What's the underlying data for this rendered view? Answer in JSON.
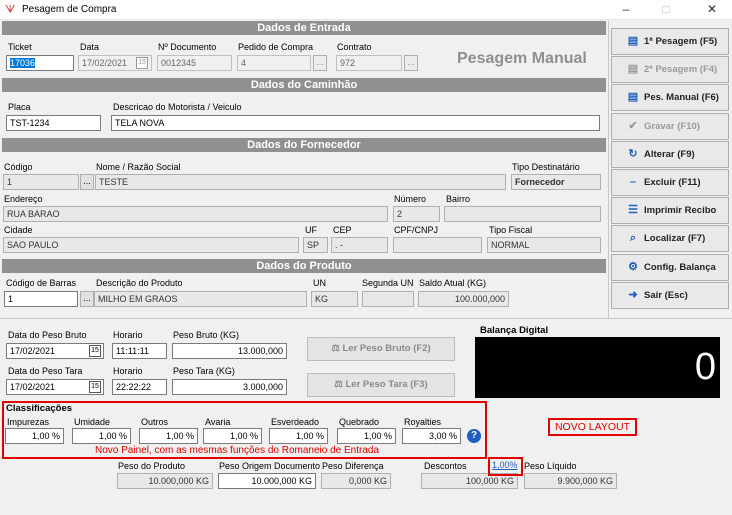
{
  "window": {
    "title": "Pesagem de Compra",
    "minimize": "–",
    "maximize": "□",
    "close": "✕"
  },
  "sections": {
    "entrada": "Dados de Entrada",
    "caminhao": "Dados do Caminhão",
    "fornecedor": "Dados do Fornecedor",
    "produto": "Dados do Produto",
    "balanca": "Balança Digital",
    "classificacoes": "Classificações"
  },
  "entrada": {
    "ticket_label": "Ticket",
    "ticket": "17036",
    "data_label": "Data",
    "data": "17/02/2021",
    "documento_label": "Nº Documento",
    "documento": "0012345",
    "pedido_label": "Pedido de Compra",
    "pedido": "4",
    "contrato_label": "Contrato",
    "contrato": "972",
    "mode_title": "Pesagem Manual",
    "dots": "..."
  },
  "caminhao": {
    "placa_label": "Placa",
    "placa": "TST-1234",
    "motorista_label": "Descricao do Motorista / Veiculo",
    "motorista": "TELA NOVA"
  },
  "fornecedor": {
    "codigo_label": "Código",
    "codigo": "1",
    "nome_label": "Nome / Razão Social",
    "nome": "TESTE",
    "tipo_label": "Tipo Destinatário",
    "tipo": "Fornecedor",
    "endereco_label": "Endereço",
    "endereco": "RUA BARAO",
    "numero_label": "Número",
    "numero": "2",
    "bairro_label": "Bairro",
    "bairro": "",
    "cidade_label": "Cidade",
    "cidade": "SAO PAULO",
    "uf_label": "UF",
    "uf": "SP",
    "cep_label": "CEP",
    "cep": " .  -",
    "cpf_label": "CPF/CNPJ",
    "cpf": "",
    "tipo_fiscal_label": "Tipo Fiscal",
    "tipo_fiscal": "NORMAL"
  },
  "produto": {
    "barras_label": "Código de Barras",
    "barras": "1",
    "descricao_label": "Descrição do Produto",
    "descricao": "MILHO EM GRAOS",
    "un_label": "UN",
    "un": "KG",
    "segunda_un_label": "Segunda UN",
    "segunda_un": "",
    "saldo_label": "Saldo Atual (KG)",
    "saldo": "100.000,000"
  },
  "pesagem": {
    "data_bruto_label": "Data do Peso Bruto",
    "data_bruto": "17/02/2021",
    "hora_bruto_label": "Horario",
    "hora_bruto": "11:11:11",
    "peso_bruto_label": "Peso Bruto (KG)",
    "peso_bruto": "13.000,000",
    "ler_bruto": "Ler Peso Bruto (F2)",
    "data_tara_label": "Data do Peso Tara",
    "data_tara": "17/02/2021",
    "hora_tara_label": "Horario",
    "hora_tara": "22:22:22",
    "peso_tara_label": "Peso Tara (KG)",
    "peso_tara": "3.000,000",
    "ler_tara": "Ler Peso Tara (F3)",
    "balanca_valor": "0",
    "cal_icon": "15"
  },
  "classificacoes": {
    "items": [
      {
        "label": "Impurezas",
        "value": "1,00 %"
      },
      {
        "label": "Umidade",
        "value": "1,00 %"
      },
      {
        "label": "Outros",
        "value": "1,00 %"
      },
      {
        "label": "Avaria",
        "value": "1,00 %"
      },
      {
        "label": "Esverdeado",
        "value": "1,00 %"
      },
      {
        "label": "Quebrado",
        "value": "1,00 %"
      },
      {
        "label": "Royalties",
        "value": "3,00 %"
      }
    ],
    "help": "?",
    "note": "Novo Painel, com as mesmas funções do Romaneio de Entrada",
    "novo_layout": "NOVO LAYOUT"
  },
  "totais": {
    "peso_produto_label": "Peso do Produto",
    "peso_produto": "10.000,000 KG",
    "peso_origem_label": "Peso Origem Documento",
    "peso_origem": "10.000,000 KG",
    "peso_diferenca_label": "Peso Diferença",
    "peso_diferenca": "0,000 KG",
    "descontos_label": "Descontos",
    "descontos": "100,000 KG",
    "descontos_pct": "1,00%",
    "peso_liquido_label": "Peso Líquido",
    "peso_liquido": "9.900,000 KG"
  },
  "sidebar": [
    {
      "label": "1ª Pesagem (F5)",
      "icon": "▤"
    },
    {
      "label": "2ª Pesagem (F4)",
      "icon": "▤"
    },
    {
      "label": "Pes. Manual (F6)",
      "icon": "▤"
    },
    {
      "label": "Gravar (F10)",
      "icon": "✔"
    },
    {
      "label": "Alterar (F9)",
      "icon": "↻"
    },
    {
      "label": "Excluir (F11)",
      "icon": "–"
    },
    {
      "label": "Imprimir Recibo",
      "icon": "☰"
    },
    {
      "label": "Localizar (F7)",
      "icon": "⌕"
    },
    {
      "label": "Config. Balança",
      "icon": "⚙"
    },
    {
      "label": "Sair (Esc)",
      "icon": "➜"
    }
  ],
  "colors": {
    "band": "#909090",
    "accent": "#1f5fbf",
    "highlight": "#e00000"
  }
}
